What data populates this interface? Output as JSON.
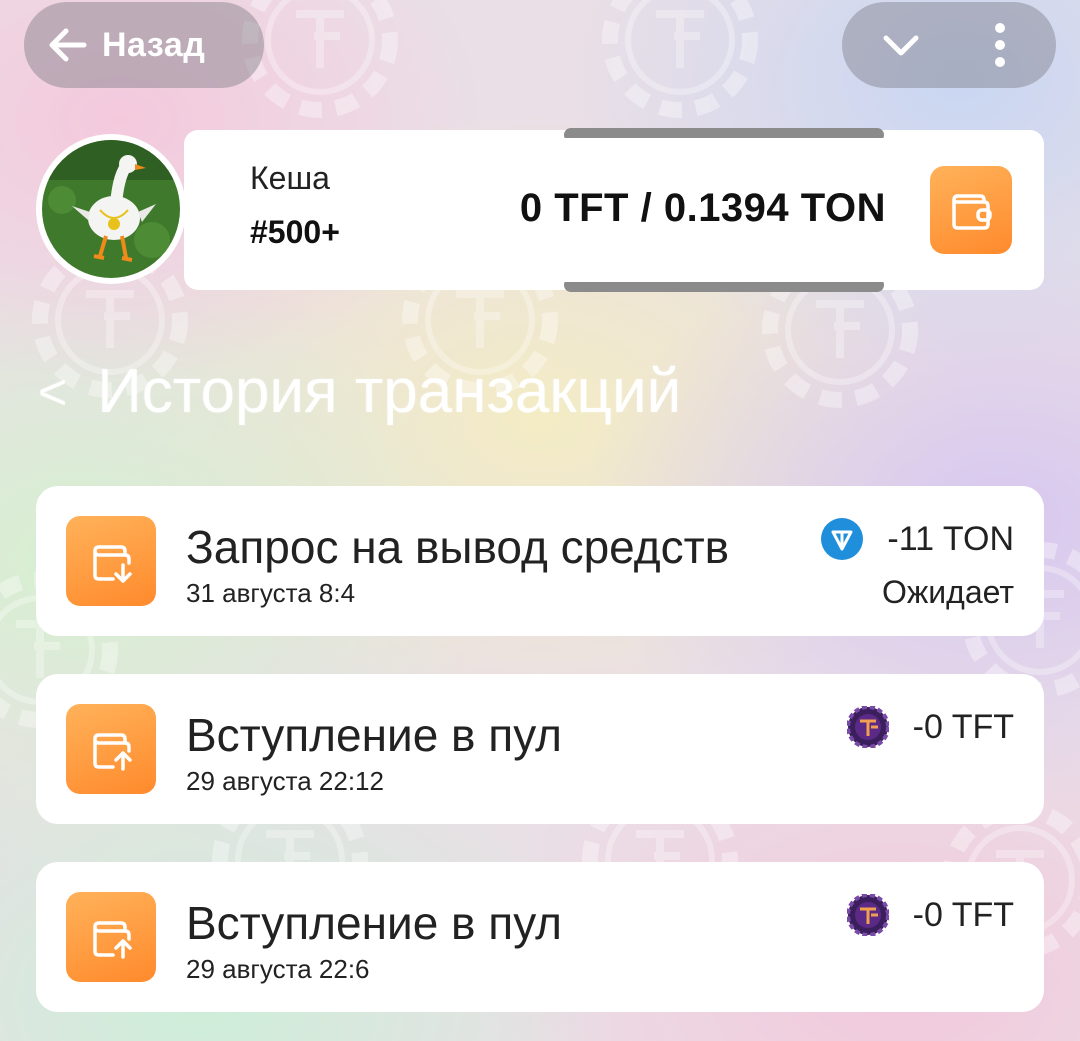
{
  "header": {
    "back_label": "Назад",
    "back_icon": "arrow-left-icon",
    "collapse_icon": "chevron-down-icon",
    "more_icon": "vertical-dots-icon"
  },
  "profile": {
    "name": "Кеша",
    "rank": "#500+",
    "balance": "0 TFT / 0.1394 TON",
    "wallet_icon": "wallet-icon"
  },
  "history": {
    "title": "История транзакций",
    "back_glyph": "<"
  },
  "transactions": [
    {
      "title": "Запрос на вывод средств",
      "date": "31 августа 8:4",
      "amount": "-11 TON",
      "coin": "ton-icon",
      "status": "Ожидает",
      "icon": "wallet-withdraw-icon"
    },
    {
      "title": "Вступление в пул",
      "date": "29 августа 22:12",
      "amount": "-0 TFT",
      "coin": "tft-icon",
      "status": "",
      "icon": "wallet-deposit-icon"
    },
    {
      "title": "Вступление в пул",
      "date": "29 августа 22:6",
      "amount": "-0 TFT",
      "coin": "tft-icon",
      "status": "",
      "icon": "wallet-deposit-icon"
    }
  ],
  "colors": {
    "accent_orange": "#ff8a2c",
    "ton_blue": "#1f8fdc",
    "tft_purple": "#5b2a86"
  }
}
